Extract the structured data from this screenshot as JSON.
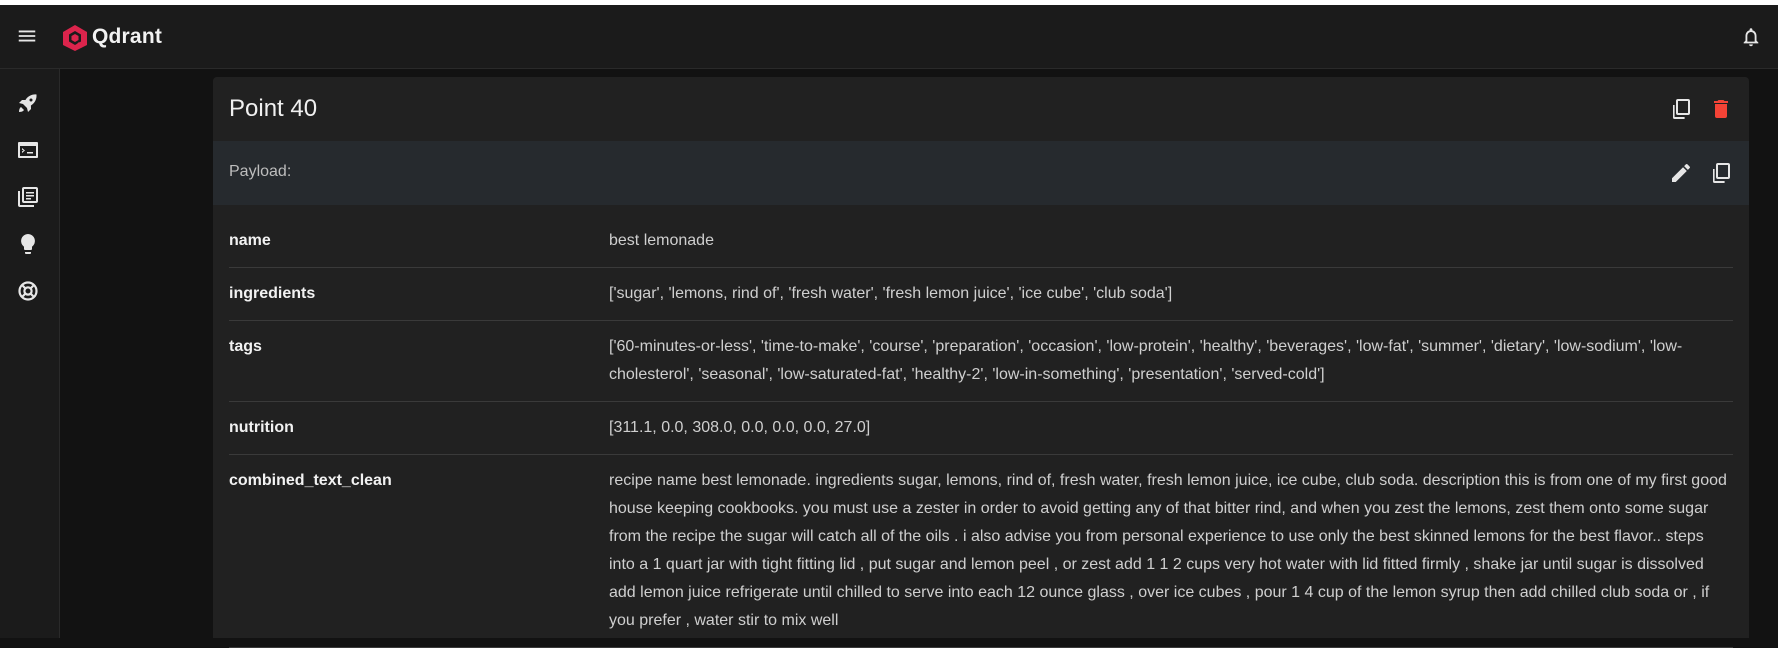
{
  "app": {
    "brand": "Qdrant"
  },
  "colors": {
    "accent": "#dc244c",
    "delete": "#f44336"
  },
  "icons": {
    "menu": "menu-icon",
    "bell": "bell-icon",
    "sidebar": [
      "rocket-icon",
      "terminal-icon",
      "library-icon",
      "lightbulb-icon",
      "support-icon"
    ],
    "copy": "copy-icon",
    "delete": "delete-icon",
    "edit": "pencil-icon"
  },
  "point": {
    "title": "Point 40",
    "payload_label": "Payload:",
    "rows": [
      {
        "key": "name",
        "value": "best lemonade"
      },
      {
        "key": "ingredients",
        "value": "['sugar', 'lemons, rind of', 'fresh water', 'fresh lemon juice', 'ice cube', 'club soda']"
      },
      {
        "key": "tags",
        "value": "['60-minutes-or-less', 'time-to-make', 'course', 'preparation', 'occasion', 'low-protein', 'healthy', 'beverages', 'low-fat', 'summer', 'dietary', 'low-sodium', 'low-cholesterol', 'seasonal', 'low-saturated-fat', 'healthy-2', 'low-in-something', 'presentation', 'served-cold']"
      },
      {
        "key": "nutrition",
        "value": "[311.1, 0.0, 308.0, 0.0, 0.0, 0.0, 27.0]"
      },
      {
        "key": "combined_text_clean",
        "value": "recipe name best lemonade. ingredients sugar, lemons, rind of, fresh water, fresh lemon juice, ice cube, club soda. description this is from one of my first good house keeping cookbooks. you must use a zester in order to avoid getting any of that bitter rind, and when you zest the lemons, zest them onto some sugar from the recipe the sugar will catch all of the oils . i also advise you from personal experience to use only the best skinned lemons for the best flavor.. steps into a 1 quart jar with tight fitting lid , put sugar and lemon peel , or zest add 1 1 2 cups very hot water with lid fitted firmly , shake jar until sugar is dissolved add lemon juice refrigerate until chilled to serve into each 12 ounce glass , over ice cubes , pour 1 4 cup of the lemon syrup then add chilled club soda or , if you prefer , water stir to mix well"
      }
    ]
  }
}
